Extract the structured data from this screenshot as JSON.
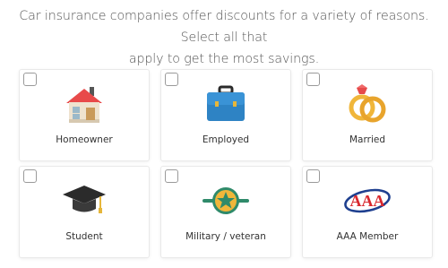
{
  "intro": {
    "line1": "Car insurance companies offer discounts for a variety of reasons. Select all that",
    "line2": "apply to get the most savings."
  },
  "options": [
    {
      "label": "Homeowner",
      "icon": "house-icon",
      "checked": false
    },
    {
      "label": "Employed",
      "icon": "briefcase-icon",
      "checked": false
    },
    {
      "label": "Married",
      "icon": "wedding-rings-icon",
      "checked": false
    },
    {
      "label": "Student",
      "icon": "graduation-cap-icon",
      "checked": false
    },
    {
      "label": "Military / veteran",
      "icon": "military-medal-icon",
      "checked": false
    },
    {
      "label": "AAA Member",
      "icon": "aaa-logo-icon",
      "checked": false
    }
  ],
  "colors": {
    "house_roof": "#e84a4a",
    "briefcase": "#2e83c4",
    "ring_gold": "#f0b63a",
    "ring_gem": "#e64a4a",
    "cap": "#2b2b2b",
    "tassel": "#e6b63a",
    "medal_green": "#2f8a6a",
    "medal_gold": "#f0b63a",
    "aaa_red": "#d8282e",
    "aaa_blue": "#1e3f8f"
  }
}
